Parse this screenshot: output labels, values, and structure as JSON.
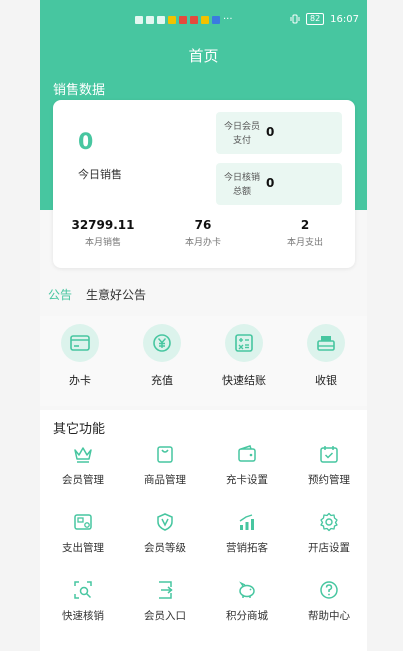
{
  "statusbar": {
    "battery": "82",
    "time": "16:07",
    "more": "···"
  },
  "header": {
    "title": "首页"
  },
  "sales": {
    "section_title": "销售数据",
    "today_value": "0",
    "today_label": "今日销售",
    "member_pay_label": "今日会员支付",
    "member_pay_value": "0",
    "verify_total_label": "今日核销总额",
    "verify_total_value": "0",
    "month": [
      {
        "value": "32799.11",
        "label": "本月销售"
      },
      {
        "value": "76",
        "label": "本月办卡"
      },
      {
        "value": "2",
        "label": "本月支出"
      }
    ]
  },
  "notice": {
    "tag": "公告",
    "text": "生意好公告"
  },
  "quick": [
    {
      "label": "办卡",
      "icon": "card-icon"
    },
    {
      "label": "充值",
      "icon": "yen-recharge-icon"
    },
    {
      "label": "快速结账",
      "icon": "calculator-icon"
    },
    {
      "label": "收银",
      "icon": "cash-register-icon"
    }
  ],
  "other": {
    "title": "其它功能",
    "items": [
      {
        "label": "会员管理",
        "icon": "crown-icon"
      },
      {
        "label": "商品管理",
        "icon": "shopping-bag-icon"
      },
      {
        "label": "充卡设置",
        "icon": "wallet-icon"
      },
      {
        "label": "预约管理",
        "icon": "calendar-check-icon"
      },
      {
        "label": "支出管理",
        "icon": "expense-icon"
      },
      {
        "label": "会员等级",
        "icon": "shield-v-icon"
      },
      {
        "label": "营销拓客",
        "icon": "growth-chart-icon"
      },
      {
        "label": "开店设置",
        "icon": "gear-icon"
      },
      {
        "label": "快速核销",
        "icon": "scan-search-icon"
      },
      {
        "label": "会员入口",
        "icon": "login-door-icon"
      },
      {
        "label": "积分商城",
        "icon": "piggy-bank-icon"
      },
      {
        "label": "帮助中心",
        "icon": "help-icon"
      }
    ]
  },
  "colors": {
    "accent": "#47c6a0",
    "accent_light": "#dcf3ec"
  }
}
